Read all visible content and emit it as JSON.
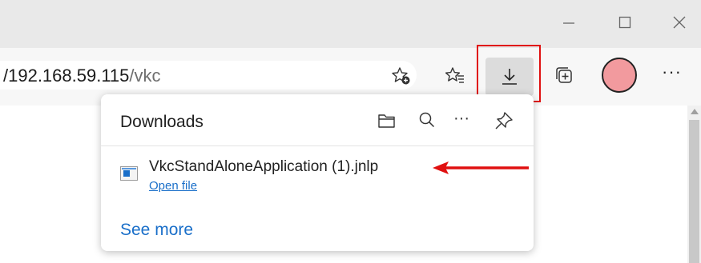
{
  "browser": {
    "address_url_host": "/192.168.59.115",
    "address_url_path": "/vkc"
  },
  "toolbar": {
    "more_label": "···"
  },
  "downloads_panel": {
    "title": "Downloads",
    "more_label": "···",
    "items": [
      {
        "filename": "VkcStandAloneApplication (1).jnlp",
        "action_label": "Open file"
      }
    ],
    "see_more_label": "See more"
  },
  "colors": {
    "highlight_box": "#e01010",
    "avatar": "#f29a9e",
    "link": "#1a6fc9"
  },
  "icons": {
    "window": [
      "minimize-icon",
      "maximize-icon",
      "close-icon"
    ],
    "toolbar": [
      "add-favorite-icon",
      "favorites-icon",
      "download-icon",
      "collections-icon",
      "profile-avatar",
      "more-icon"
    ],
    "panel": [
      "open-folder-icon",
      "search-icon",
      "more-icon",
      "pin-icon"
    ],
    "file": "jnlp-file-icon"
  }
}
